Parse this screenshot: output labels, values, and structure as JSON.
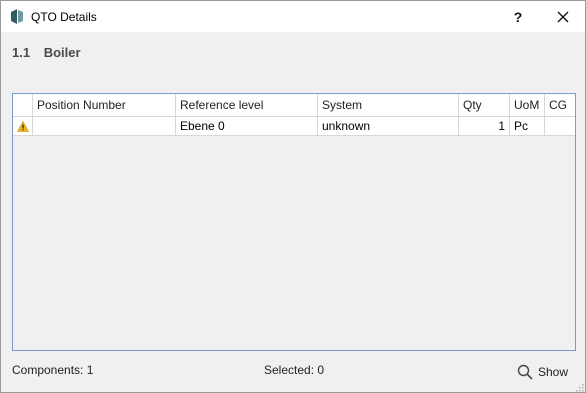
{
  "window": {
    "title": "QTO Details",
    "help_label": "?"
  },
  "section": {
    "number": "1.1",
    "title": "Boiler"
  },
  "table": {
    "columns": [
      "",
      "Position Number",
      "Reference level",
      "System",
      "Qty",
      "UoM",
      "CG"
    ],
    "rows": [
      {
        "status_icon": "warning-icon",
        "position_number": "",
        "reference_level": "Ebene 0",
        "system": "unknown",
        "qty": "1",
        "uom": "Pc",
        "cg": ""
      }
    ]
  },
  "status": {
    "components": "Components: 1",
    "selected": "Selected: 0",
    "show_label": "Show",
    "show_icon": "search-icon"
  },
  "colors": {
    "grid_border": "#7a9cc6",
    "warning": "#f2b418",
    "app_icon": "#2f5d62"
  }
}
